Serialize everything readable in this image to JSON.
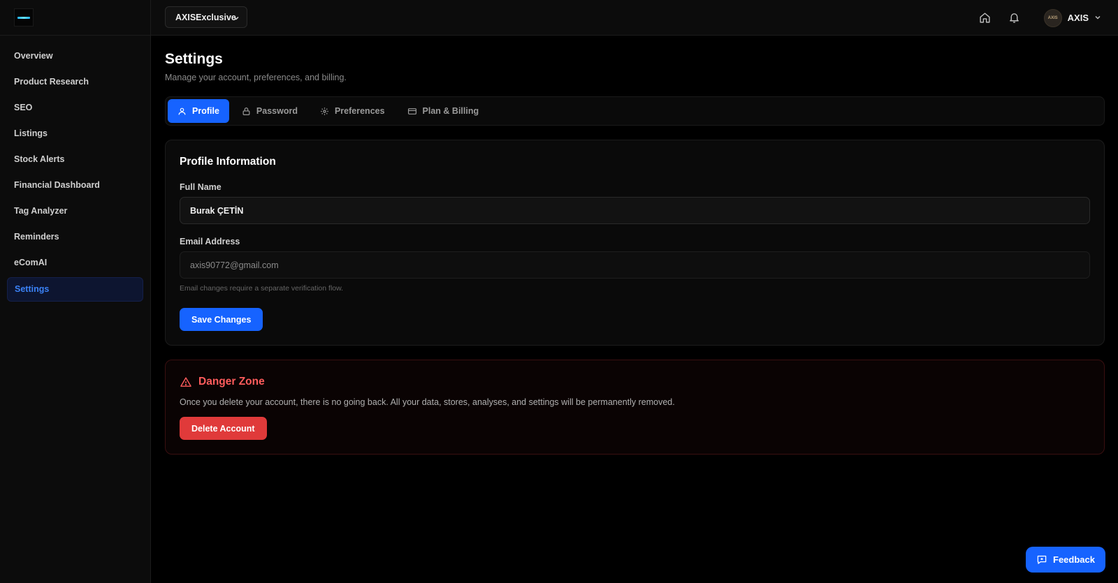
{
  "app": {
    "logo_icon": "brand-logo-icon"
  },
  "sidebar": {
    "items": [
      {
        "label": "Overview"
      },
      {
        "label": "Product Research"
      },
      {
        "label": "SEO"
      },
      {
        "label": "Listings"
      },
      {
        "label": "Stock Alerts"
      },
      {
        "label": "Financial Dashboard"
      },
      {
        "label": "Tag Analyzer"
      },
      {
        "label": "Reminders"
      },
      {
        "label": "eComAI"
      },
      {
        "label": "Settings",
        "active": true
      }
    ]
  },
  "topbar": {
    "store_selector": {
      "value": "AXISExclusive"
    },
    "icons": [
      "home-icon",
      "bell-icon"
    ],
    "user": {
      "name": "AXIS",
      "avatar_text": "AXIS"
    }
  },
  "page": {
    "title": "Settings",
    "subtitle": "Manage your account, preferences, and billing."
  },
  "tabs": [
    {
      "label": "Profile",
      "icon": "user-icon",
      "active": true
    },
    {
      "label": "Password",
      "icon": "lock-icon"
    },
    {
      "label": "Preferences",
      "icon": "gear-icon"
    },
    {
      "label": "Plan & Billing",
      "icon": "credit-card-icon"
    }
  ],
  "profile": {
    "title": "Profile Information",
    "full_name_label": "Full Name",
    "full_name_value": "Burak ÇETİN",
    "email_label": "Email Address",
    "email_value": "axis90772@gmail.com",
    "email_helper": "Email changes require a separate verification flow.",
    "save_label": "Save Changes"
  },
  "danger_zone": {
    "title": "Danger Zone",
    "text": "Once you delete your account, there is no going back. All your data, stores, analyses, and settings will be permanently removed.",
    "delete_label": "Delete Account"
  },
  "feedback": {
    "label": "Feedback"
  },
  "colors": {
    "accent": "#1663ff",
    "danger": "#e03a3a",
    "background": "#000000",
    "sidebar": "#0c0c0c"
  }
}
